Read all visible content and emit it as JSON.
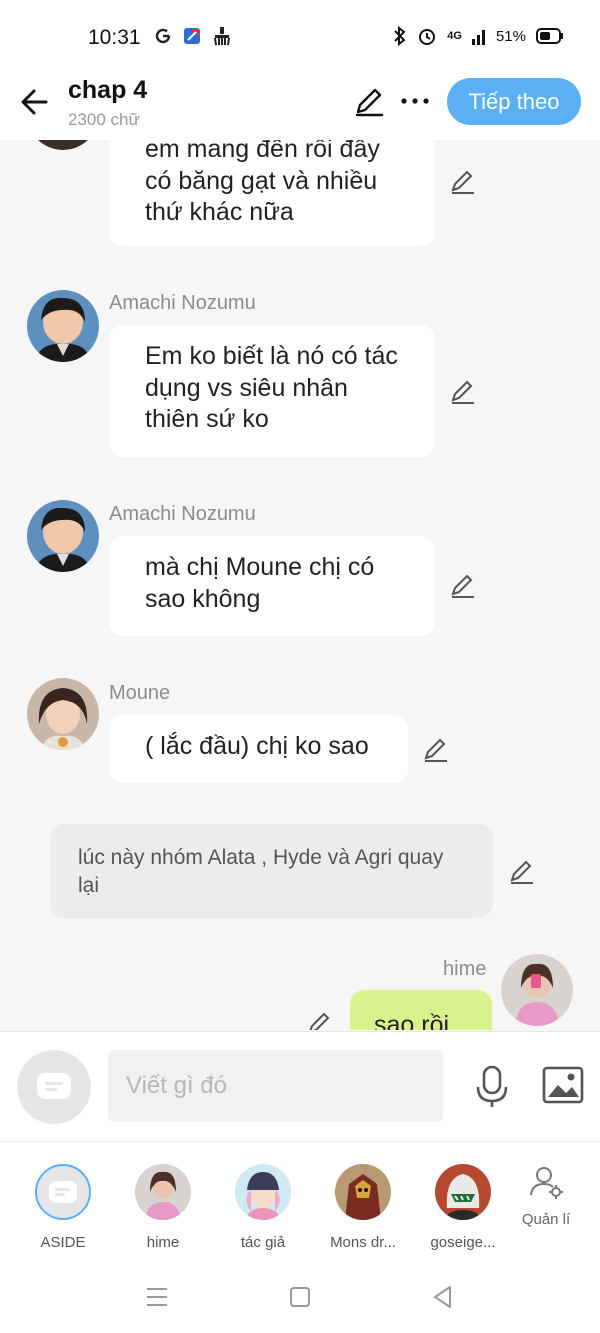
{
  "status": {
    "time": "10:31",
    "battery": "51%",
    "network": "4G"
  },
  "header": {
    "title": "chap 4",
    "subtitle": "2300 chữ",
    "next_label": "Tiếp theo"
  },
  "messages": [
    {
      "sender": "",
      "text": "em mang đến rồi đây có băng gạt và nhiều thứ khác nữa"
    },
    {
      "sender": "Amachi Nozumu",
      "text": "Em ko biết là nó có tác dụng vs siêu nhân thiên sứ ko"
    },
    {
      "sender": "Amachi Nozumu",
      "text": "mà chị Moune chị có sao không"
    },
    {
      "sender": "Moune",
      "text": "( lắc đầu) chị ko sao"
    }
  ],
  "narration": "lúc này nhóm Alata , Hyde và Agri quay lại",
  "self_message": {
    "sender": "hime",
    "text": "sao rồi"
  },
  "input": {
    "placeholder": "Viết gì đó"
  },
  "characters": [
    {
      "label": "ASIDE"
    },
    {
      "label": "hime"
    },
    {
      "label": "tác giả"
    },
    {
      "label": "Mons dr..."
    },
    {
      "label": "goseige..."
    }
  ],
  "manage_label": "Quản lí",
  "colors": {
    "accent": "#5ab0f3",
    "self_bubble": "#d8f38d",
    "background": "#f6f6f7"
  }
}
